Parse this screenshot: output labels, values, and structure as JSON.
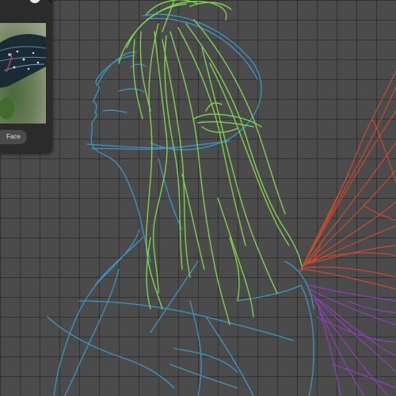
{
  "app": {
    "canvas_background": "#4b4b4b",
    "grid_color": "#2a2a2a"
  },
  "reference_panel": {
    "label": "Face",
    "close_icon": "close-icon"
  },
  "sketch_layers": [
    {
      "name": "body",
      "color": "#3a9fd0"
    },
    {
      "name": "hair",
      "color": "#7fd14f"
    },
    {
      "name": "wing-upper",
      "color": "#d94a2e"
    },
    {
      "name": "wing-lower",
      "color": "#9a3dc9"
    }
  ]
}
